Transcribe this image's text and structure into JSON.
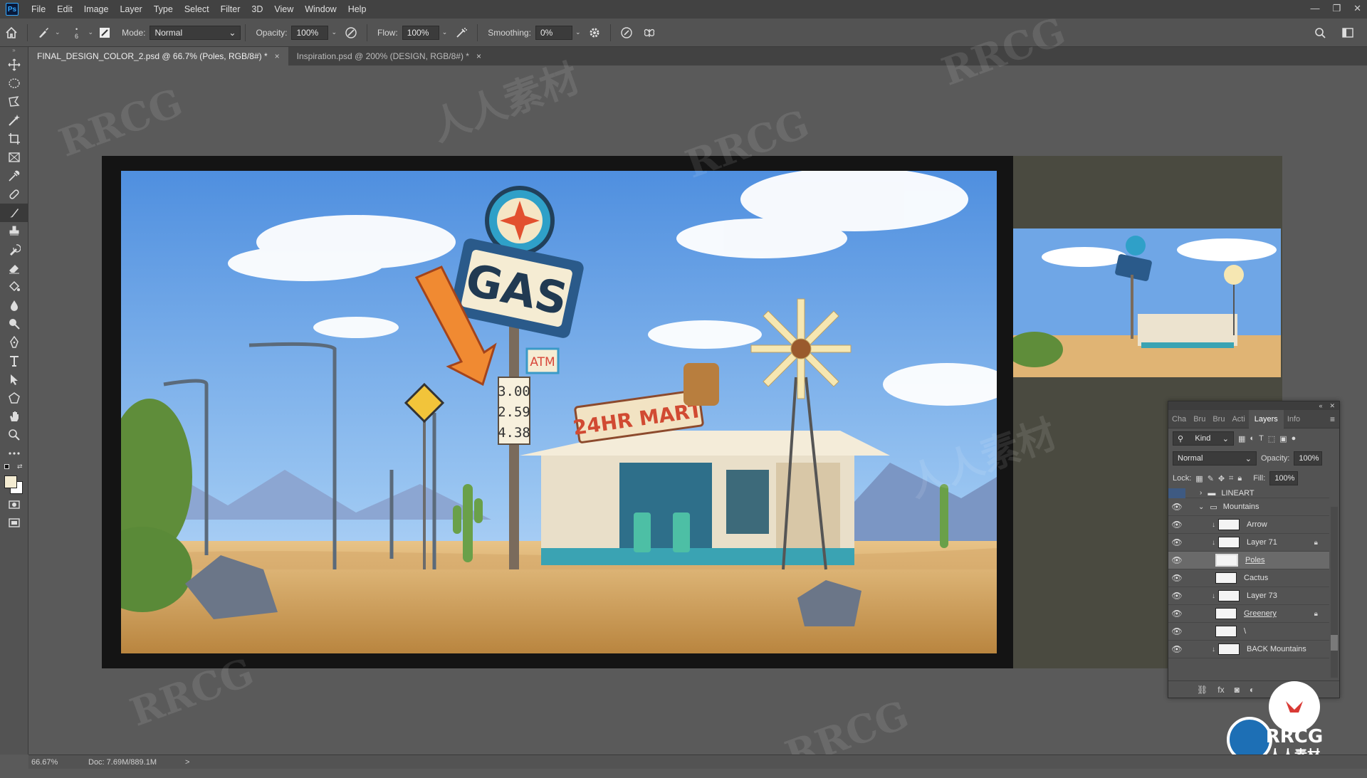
{
  "app": {
    "logo": "Ps"
  },
  "menu": [
    "File",
    "Edit",
    "Image",
    "Layer",
    "Type",
    "Select",
    "Filter",
    "3D",
    "View",
    "Window",
    "Help"
  ],
  "window_controls": [
    "—",
    "❐",
    "✕"
  ],
  "options": {
    "brush_size": "6",
    "mode_label": "Mode:",
    "mode_value": "Normal",
    "opacity_label": "Opacity:",
    "opacity_value": "100%",
    "flow_label": "Flow:",
    "flow_value": "100%",
    "smoothing_label": "Smoothing:",
    "smoothing_value": "0%"
  },
  "tabs": [
    {
      "label": "FINAL_DESIGN_COLOR_2.psd @ 66.7% (Poles, RGB/8#) *",
      "close": "×"
    },
    {
      "label": "Inspiration.psd @ 200% (DESIGN, RGB/8#) *",
      "close": "×"
    }
  ],
  "artwork": {
    "gas_sign": "GAS",
    "atm_sign": "ATM",
    "prices": [
      "3.00",
      "2.59",
      "4.38"
    ],
    "mart_sign": "24HR MART"
  },
  "layers_panel": {
    "tabs": [
      "Cha",
      "Bru",
      "Bru",
      "Acti",
      "Layers",
      "Info"
    ],
    "filter_label": "Kind",
    "blend_mode": "Normal",
    "opacity_label": "Opacity:",
    "opacity_value": "100%",
    "lock_label": "Lock:",
    "fill_label": "Fill:",
    "fill_value": "100%",
    "layers": [
      {
        "name": "LINEART",
        "type": "group",
        "visible": false
      },
      {
        "name": "Mountains",
        "type": "group",
        "visible": true
      },
      {
        "name": "Arrow",
        "clipped": true,
        "visible": true
      },
      {
        "name": "Layer 71",
        "clipped": true,
        "locked": true,
        "visible": true
      },
      {
        "name": "Poles",
        "selected": true,
        "visible": true
      },
      {
        "name": "Cactus",
        "visible": true
      },
      {
        "name": "Layer 73",
        "clipped": true,
        "visible": true
      },
      {
        "name": "Greenery",
        "locked": true,
        "visible": true
      },
      {
        "name": "\\",
        "visible": true
      },
      {
        "name": "BACK Mountains",
        "clipped": true,
        "visible": true
      }
    ]
  },
  "status": {
    "zoom": "66.67%",
    "doc": "Doc: 7.69M/889.1M",
    "arrow": ">"
  },
  "watermark": {
    "text": "RRCG",
    "text2": "人人素材"
  },
  "colors": {
    "accent": "#31a8ff",
    "sky": "#6ea8ea",
    "ground": "#d9a867",
    "sign_blue": "#2a5a8a"
  }
}
